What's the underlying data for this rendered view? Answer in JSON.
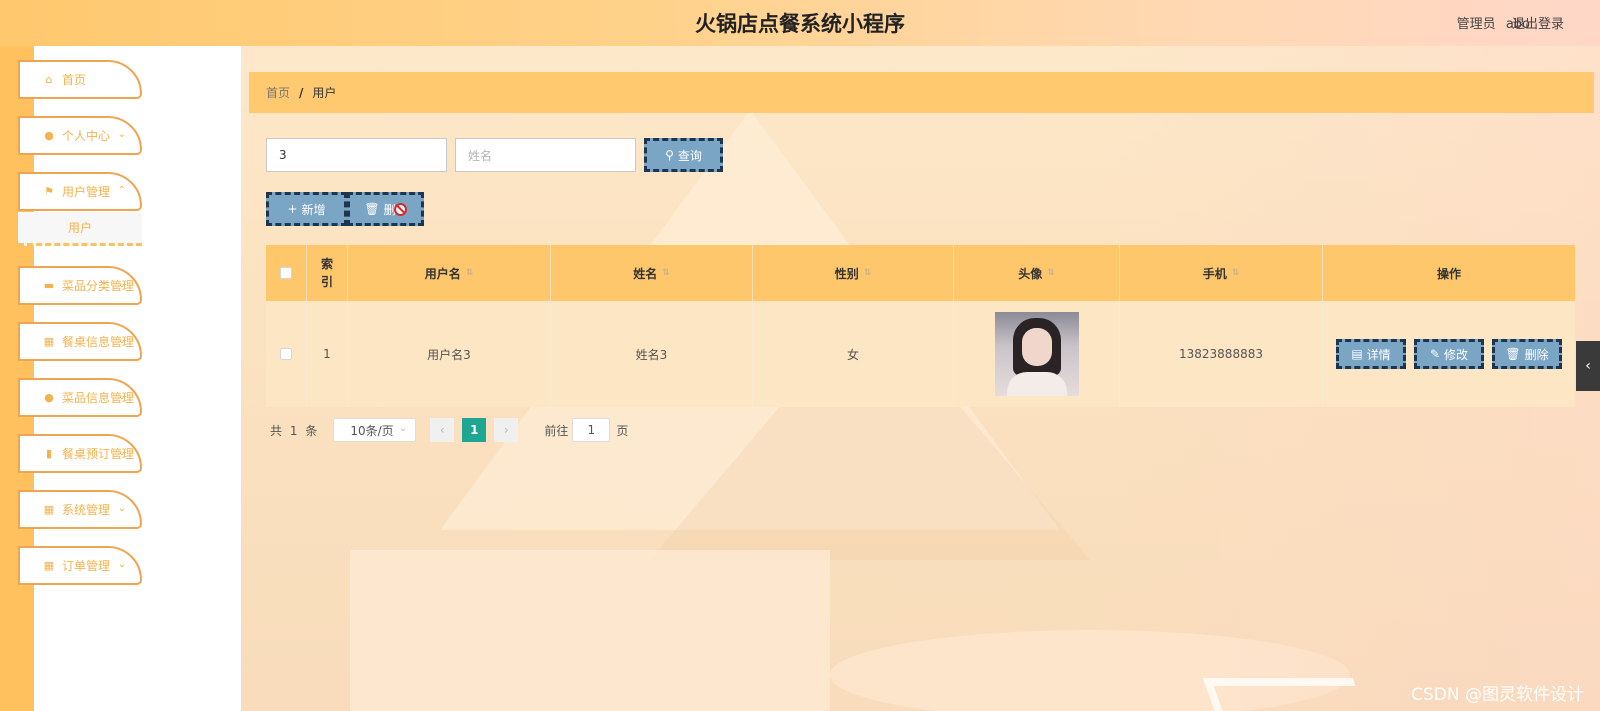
{
  "app": {
    "title": "火锅店点餐系统小程序",
    "user_role": "管理员",
    "user_name": "abo",
    "logout": "退出登录"
  },
  "sidebar": {
    "items": [
      {
        "label": "首页",
        "icon": "home-icon",
        "has_arrow": false
      },
      {
        "label": "个人中心",
        "icon": "person-icon",
        "has_arrow": true
      },
      {
        "label": "用户管理",
        "icon": "flag-icon",
        "has_arrow": true
      },
      {
        "label": "菜品分类管理",
        "icon": "chat-icon",
        "has_arrow": true
      },
      {
        "label": "餐桌信息管理",
        "icon": "grid-icon",
        "has_arrow": true
      },
      {
        "label": "菜品信息管理",
        "icon": "location-icon",
        "has_arrow": true
      },
      {
        "label": "餐桌预订管理",
        "icon": "bar-chart-icon",
        "has_arrow": true
      },
      {
        "label": "系统管理",
        "icon": "apps-icon",
        "has_arrow": true
      },
      {
        "label": "订单管理",
        "icon": "apps-icon",
        "has_arrow": true
      }
    ],
    "submenu": {
      "label": "用户"
    }
  },
  "breadcrumb": {
    "home": "首页",
    "separator": "/",
    "current": "用户"
  },
  "search": {
    "username_value": "3",
    "name_placeholder": "姓名",
    "query_button": "查询"
  },
  "toolbar": {
    "add_button": "新增",
    "delete_button": "删"
  },
  "table": {
    "headers": {
      "index": "索引",
      "username": "用户名",
      "name": "姓名",
      "gender": "性别",
      "avatar": "头像",
      "phone": "手机",
      "actions": "操作"
    },
    "rows": [
      {
        "index": "1",
        "username": "用户名3",
        "name": "姓名3",
        "gender": "女",
        "phone": "13823888883"
      }
    ],
    "row_actions": {
      "detail": "详情",
      "edit": "修改",
      "delete": "删除"
    }
  },
  "pagination": {
    "total_prefix": "共",
    "total": "1",
    "total_suffix": "条",
    "page_size": "10条/页",
    "current_page": "1",
    "goto_label": "前往",
    "goto_value": "1",
    "page_suffix": "页"
  },
  "watermark": "CSDN @图灵软件设计",
  "colors": {
    "header_start": "#ffc86e",
    "sidebar_accent": "#f0a451",
    "breadcrumb_bg": "#ffc96f",
    "button_bg": "#7aa5c4",
    "pager_active": "#1fa594"
  }
}
